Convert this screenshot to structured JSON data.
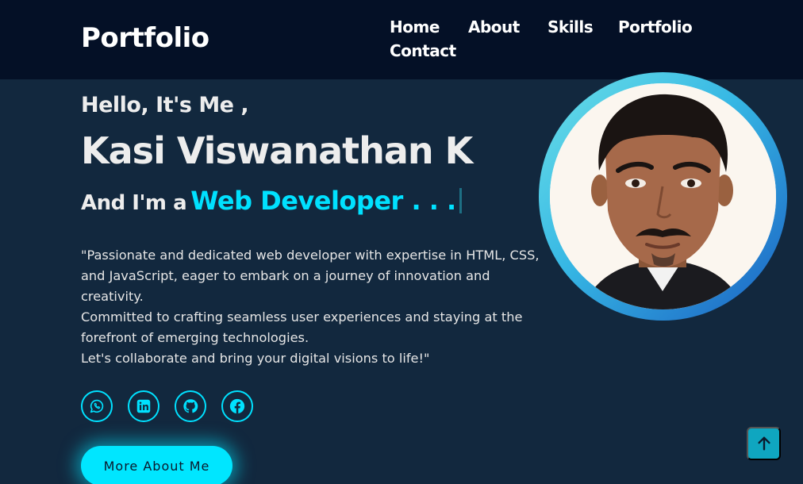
{
  "header": {
    "logo": "Portfolio",
    "nav": {
      "home": "Home",
      "about": "About",
      "skills": "Skills",
      "portfolio": "Portfolio",
      "contact": "Contact"
    }
  },
  "hero": {
    "greeting": "Hello, It's Me ,",
    "name": "Kasi Viswanathan K",
    "role_prefix": "And I'm a",
    "role": "Web Developer . . .",
    "bio": {
      "line1": "\"Passionate and dedicated web developer with expertise in HTML, CSS,",
      "line2": "and JavaScript, eager to embark on a journey of innovation and",
      "line3": "creativity.",
      "line4": "Committed to crafting seamless user experiences and staying at the",
      "line5": "forefront of emerging technologies.",
      "line6": "Let's collaborate and bring your digital visions to life!\""
    },
    "socials": [
      "whatsapp-icon",
      "linkedin-icon",
      "github-icon",
      "facebook-icon"
    ],
    "cta_label": "More About Me"
  },
  "colors": {
    "header_bg": "#041026",
    "page_bg": "#12283e",
    "accent": "#00e1ff",
    "scroll_top_bg": "#0fa6c0"
  },
  "scroll_top_icon": "arrow-up-icon"
}
